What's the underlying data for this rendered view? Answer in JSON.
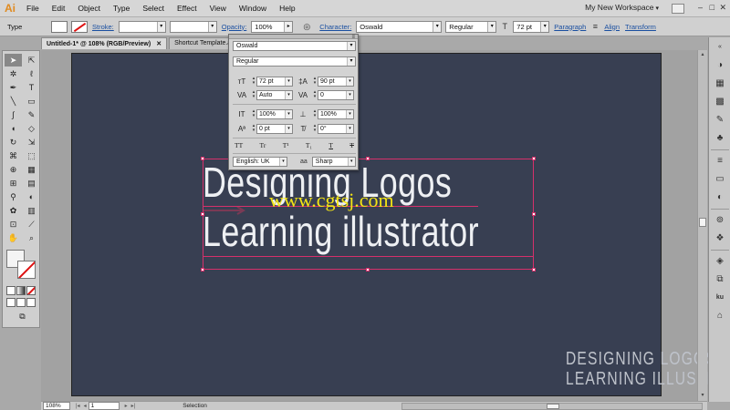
{
  "app": {
    "logo": "Ai",
    "menu": [
      "File",
      "Edit",
      "Object",
      "Type",
      "Select",
      "Effect",
      "View",
      "Window",
      "Help"
    ],
    "workspace": "My New Workspace"
  },
  "control_bar": {
    "mode_label": "Type",
    "stroke_label": "Stroke:",
    "opacity_label": "Opacity:",
    "opacity_value": "100%",
    "character_label": "Character:",
    "font": "Oswald",
    "style": "Regular",
    "size": "72 pt",
    "paragraph_label": "Paragraph",
    "align_label": "Align",
    "transform_label": "Transform"
  },
  "tabs": [
    {
      "label": "Untitled-1* @ 108% (RGB/Preview)"
    },
    {
      "label": "Shortcut Template.a"
    }
  ],
  "character_panel": {
    "font_family": "Oswald",
    "font_style": "Regular",
    "font_size": "72 pt",
    "leading": "90 pt",
    "kerning": "Auto",
    "tracking": "0",
    "vertical_scale": "100%",
    "horizontal_scale": "100%",
    "baseline_shift": "0 pt",
    "rotation": "0°",
    "language": "English: UK",
    "antialiasing_label": "aa",
    "antialiasing": "Sharp",
    "cap_buttons": [
      "TT",
      "Tr",
      "T¹",
      "T₁",
      "T",
      "T"
    ]
  },
  "artboard": {
    "background_color": "#383f52",
    "headline_line1": "Designing Logos",
    "headline_line2": "Learning illustrator",
    "watermark": "www.cgtsj.com",
    "corner_line1": "DESIGNING LOGOS",
    "corner_line2": "LEARNING ILLUSTRATOR"
  },
  "status_bar": {
    "zoom": "108%",
    "page": "1",
    "status_text": "Selection"
  },
  "colors": {
    "selection": "#d6306b",
    "watermark": "#f3e414",
    "link": "#1a4fa0",
    "app_logo": "#e08a1e"
  }
}
